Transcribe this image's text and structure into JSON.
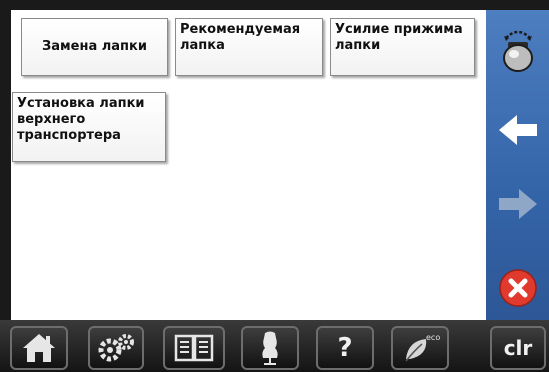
{
  "menu": {
    "presser_foot_change": "Замена лапки",
    "recommended_foot": "Рекомендуемая лапка",
    "presser_foot_pressure": "Усилие прижима лапки",
    "dual_feed_foot_setup": "Установка лапки верхнего транспортера"
  },
  "sidebar": {
    "icons": [
      "presser-foot-lever-icon",
      "back-arrow-icon",
      "forward-arrow-icon",
      "close-icon"
    ]
  },
  "toolbar": {
    "help_label": "?",
    "eco_label": "eco",
    "clear_label": "clr"
  },
  "colors": {
    "sidebar_blue": "#3a6db3",
    "close_red": "#e03a2f",
    "panel_white": "#ffffff"
  }
}
